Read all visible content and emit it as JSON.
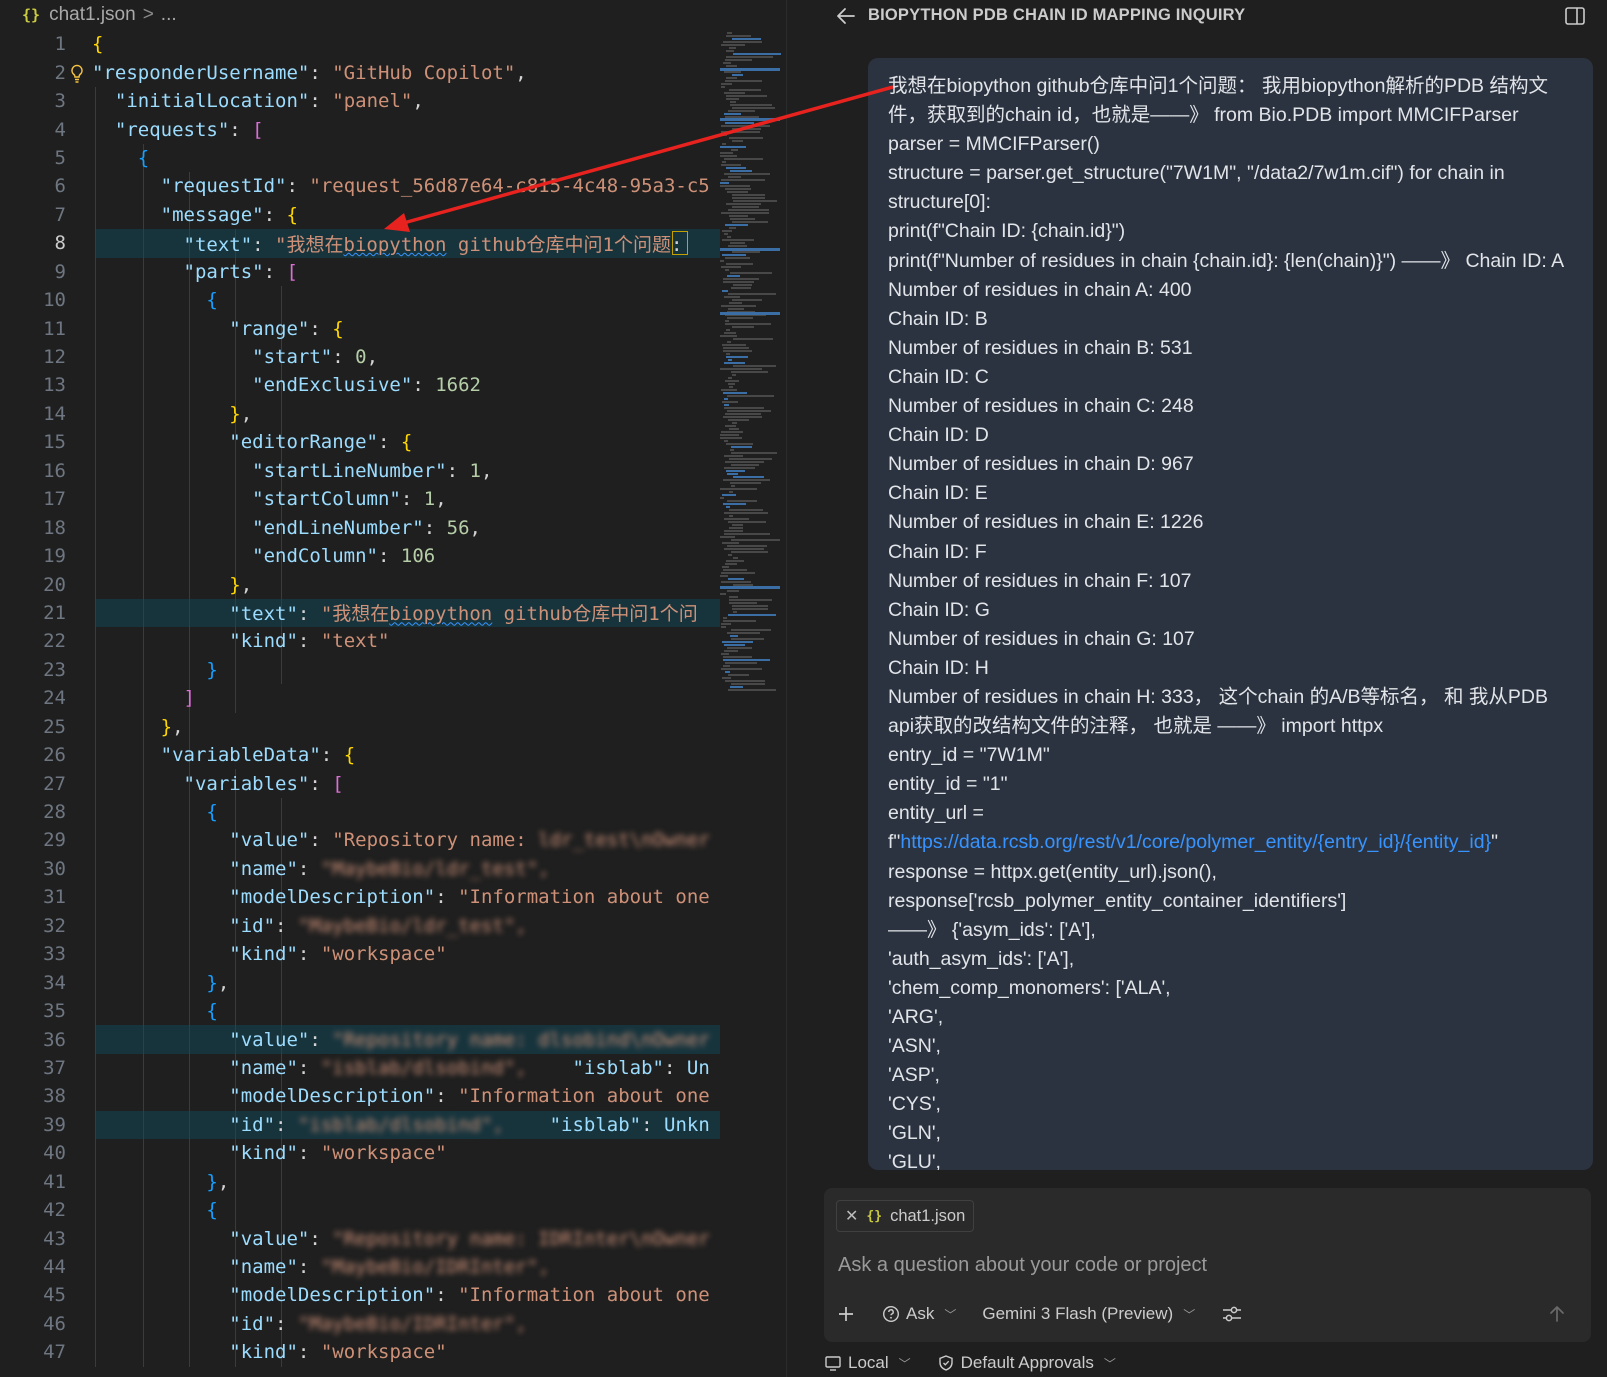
{
  "editor": {
    "breadcrumb": {
      "file_icon": "{}",
      "file": "chat1.json",
      "separator": ">",
      "more": "..."
    },
    "lines": [
      {
        "n": "1",
        "tokens": [
          [
            "b1",
            "{"
          ]
        ]
      },
      {
        "n": "2",
        "bulb": true,
        "tokens": [
          [
            "k",
            "\"responderUsername\""
          ],
          [
            "p",
            ": "
          ],
          [
            "s",
            "\"GitHub Copilot\""
          ],
          [
            "p",
            ","
          ]
        ]
      },
      {
        "n": "3",
        "tokens": [
          [
            "p",
            "  "
          ],
          [
            "k",
            "\"initialLocation\""
          ],
          [
            "p",
            ": "
          ],
          [
            "s",
            "\"panel\""
          ],
          [
            "p",
            ","
          ]
        ]
      },
      {
        "n": "4",
        "tokens": [
          [
            "p",
            "  "
          ],
          [
            "k",
            "\"requests\""
          ],
          [
            "p",
            ": "
          ],
          [
            "b2",
            "["
          ]
        ]
      },
      {
        "n": "5",
        "tokens": [
          [
            "p",
            "    "
          ],
          [
            "b3",
            "{"
          ]
        ]
      },
      {
        "n": "6",
        "tokens": [
          [
            "p",
            "      "
          ],
          [
            "k",
            "\"requestId\""
          ],
          [
            "p",
            ": "
          ],
          [
            "s",
            "\"request_56d87e64-c815-4c48-95a3-c5"
          ]
        ]
      },
      {
        "n": "7",
        "tokens": [
          [
            "p",
            "      "
          ],
          [
            "k",
            "\"message\""
          ],
          [
            "p",
            ": "
          ],
          [
            "b1",
            "{"
          ]
        ]
      },
      {
        "n": "8",
        "hl": true,
        "cur": true,
        "tokens": [
          [
            "p",
            "        "
          ],
          [
            "k",
            "\"text\""
          ],
          [
            "p",
            ": "
          ],
          [
            "s",
            "\"我想在"
          ],
          [
            "sq",
            "biopython"
          ],
          [
            "s",
            " github仓库中问1个问题"
          ],
          [
            "p",
            ":"
          ]
        ]
      },
      {
        "n": "9",
        "tokens": [
          [
            "p",
            "        "
          ],
          [
            "k",
            "\"parts\""
          ],
          [
            "p",
            ": "
          ],
          [
            "b2",
            "["
          ]
        ]
      },
      {
        "n": "10",
        "tokens": [
          [
            "p",
            "          "
          ],
          [
            "b3",
            "{"
          ]
        ]
      },
      {
        "n": "11",
        "tokens": [
          [
            "p",
            "            "
          ],
          [
            "k",
            "\"range\""
          ],
          [
            "p",
            ": "
          ],
          [
            "b1",
            "{"
          ]
        ]
      },
      {
        "n": "12",
        "tokens": [
          [
            "p",
            "              "
          ],
          [
            "k",
            "\"start\""
          ],
          [
            "p",
            ": "
          ],
          [
            "n",
            "0"
          ],
          [
            "p",
            ","
          ]
        ]
      },
      {
        "n": "13",
        "tokens": [
          [
            "p",
            "              "
          ],
          [
            "k",
            "\"endExclusive\""
          ],
          [
            "p",
            ": "
          ],
          [
            "n",
            "1662"
          ]
        ]
      },
      {
        "n": "14",
        "tokens": [
          [
            "p",
            "            "
          ],
          [
            "b1",
            "}"
          ],
          [
            "p",
            ","
          ]
        ]
      },
      {
        "n": "15",
        "tokens": [
          [
            "p",
            "            "
          ],
          [
            "k",
            "\"editorRange\""
          ],
          [
            "p",
            ": "
          ],
          [
            "b1",
            "{"
          ]
        ]
      },
      {
        "n": "16",
        "tokens": [
          [
            "p",
            "              "
          ],
          [
            "k",
            "\"startLineNumber\""
          ],
          [
            "p",
            ": "
          ],
          [
            "n",
            "1"
          ],
          [
            "p",
            ","
          ]
        ]
      },
      {
        "n": "17",
        "tokens": [
          [
            "p",
            "              "
          ],
          [
            "k",
            "\"startColumn\""
          ],
          [
            "p",
            ": "
          ],
          [
            "n",
            "1"
          ],
          [
            "p",
            ","
          ]
        ]
      },
      {
        "n": "18",
        "tokens": [
          [
            "p",
            "              "
          ],
          [
            "k",
            "\"endLineNumber\""
          ],
          [
            "p",
            ": "
          ],
          [
            "n",
            "56"
          ],
          [
            "p",
            ","
          ]
        ]
      },
      {
        "n": "19",
        "tokens": [
          [
            "p",
            "              "
          ],
          [
            "k",
            "\"endColumn\""
          ],
          [
            "p",
            ": "
          ],
          [
            "n",
            "106"
          ]
        ]
      },
      {
        "n": "20",
        "tokens": [
          [
            "p",
            "            "
          ],
          [
            "b1",
            "}"
          ],
          [
            "p",
            ","
          ]
        ]
      },
      {
        "n": "21",
        "hl": true,
        "tokens": [
          [
            "p",
            "            "
          ],
          [
            "k",
            "\"text\""
          ],
          [
            "p",
            ": "
          ],
          [
            "s",
            "\"我想在"
          ],
          [
            "sq",
            "biopython"
          ],
          [
            "s",
            " github仓库中问1个问"
          ]
        ]
      },
      {
        "n": "22",
        "tokens": [
          [
            "p",
            "            "
          ],
          [
            "k",
            "\"kind\""
          ],
          [
            "p",
            ": "
          ],
          [
            "s",
            "\"text\""
          ]
        ]
      },
      {
        "n": "23",
        "tokens": [
          [
            "p",
            "          "
          ],
          [
            "b3",
            "}"
          ]
        ]
      },
      {
        "n": "24",
        "tokens": [
          [
            "p",
            "        "
          ],
          [
            "b2",
            "]"
          ]
        ]
      },
      {
        "n": "25",
        "tokens": [
          [
            "p",
            "      "
          ],
          [
            "b1",
            "}"
          ],
          [
            "p",
            ","
          ]
        ]
      },
      {
        "n": "26",
        "tokens": [
          [
            "p",
            "      "
          ],
          [
            "k",
            "\"variableData\""
          ],
          [
            "p",
            ": "
          ],
          [
            "b1",
            "{"
          ]
        ]
      },
      {
        "n": "27",
        "tokens": [
          [
            "p",
            "        "
          ],
          [
            "k",
            "\"variables\""
          ],
          [
            "p",
            ": "
          ],
          [
            "b2",
            "["
          ]
        ]
      },
      {
        "n": "28",
        "tokens": [
          [
            "p",
            "          "
          ],
          [
            "b3",
            "{"
          ]
        ]
      },
      {
        "n": "29",
        "tokens": [
          [
            "p",
            "            "
          ],
          [
            "k",
            "\"value\""
          ],
          [
            "p",
            ": "
          ],
          [
            "s",
            "\"Repository name: "
          ],
          [
            "blur",
            "ldr_test\\nOwner"
          ]
        ]
      },
      {
        "n": "30",
        "tokens": [
          [
            "p",
            "            "
          ],
          [
            "k",
            "\"name\""
          ],
          [
            "p",
            ": "
          ],
          [
            "blur",
            "\"MaybeBio/ldr_test\","
          ]
        ]
      },
      {
        "n": "31",
        "tokens": [
          [
            "p",
            "            "
          ],
          [
            "k",
            "\"modelDescription\""
          ],
          [
            "p",
            ": "
          ],
          [
            "s",
            "\"Information about one"
          ]
        ]
      },
      {
        "n": "32",
        "tokens": [
          [
            "p",
            "            "
          ],
          [
            "k",
            "\"id\""
          ],
          [
            "p",
            ": "
          ],
          [
            "blur",
            "\"MaybeBio/ldr_test\","
          ]
        ]
      },
      {
        "n": "33",
        "tokens": [
          [
            "p",
            "            "
          ],
          [
            "k",
            "\"kind\""
          ],
          [
            "p",
            ": "
          ],
          [
            "s",
            "\"workspace\""
          ]
        ]
      },
      {
        "n": "34",
        "tokens": [
          [
            "p",
            "          "
          ],
          [
            "b3",
            "}"
          ],
          [
            "p",
            ","
          ]
        ]
      },
      {
        "n": "35",
        "tokens": [
          [
            "p",
            "          "
          ],
          [
            "b3",
            "{"
          ]
        ]
      },
      {
        "n": "36",
        "hl": true,
        "tokens": [
          [
            "p",
            "            "
          ],
          [
            "k",
            "\"value\""
          ],
          [
            "p",
            ": "
          ],
          [
            "blur",
            "\"Repository name: dlsobind\\nOwner"
          ]
        ]
      },
      {
        "n": "37",
        "tokens": [
          [
            "p",
            "            "
          ],
          [
            "k",
            "\"name\""
          ],
          [
            "p",
            ": "
          ],
          [
            "blur",
            "\"isblab/dlsobind\","
          ],
          [
            "p",
            "    "
          ],
          [
            "k",
            "\"isblab\""
          ],
          [
            "p",
            ": "
          ],
          [
            "k",
            "Un"
          ]
        ]
      },
      {
        "n": "38",
        "tokens": [
          [
            "p",
            "            "
          ],
          [
            "k",
            "\"modelDescription\""
          ],
          [
            "p",
            ": "
          ],
          [
            "s",
            "\"Information about one"
          ]
        ]
      },
      {
        "n": "39",
        "hl": true,
        "tokens": [
          [
            "p",
            "            "
          ],
          [
            "k",
            "\"id\""
          ],
          [
            "p",
            ": "
          ],
          [
            "blur",
            "\"isblab/dlsobind\","
          ],
          [
            "p",
            "    "
          ],
          [
            "k",
            "\"isblab\""
          ],
          [
            "p",
            ": "
          ],
          [
            "k",
            "Unkn"
          ]
        ]
      },
      {
        "n": "40",
        "tokens": [
          [
            "p",
            "            "
          ],
          [
            "k",
            "\"kind\""
          ],
          [
            "p",
            ": "
          ],
          [
            "s",
            "\"workspace\""
          ]
        ]
      },
      {
        "n": "41",
        "tokens": [
          [
            "p",
            "          "
          ],
          [
            "b3",
            "}"
          ],
          [
            "p",
            ","
          ]
        ]
      },
      {
        "n": "42",
        "tokens": [
          [
            "p",
            "          "
          ],
          [
            "b3",
            "{"
          ]
        ]
      },
      {
        "n": "43",
        "tokens": [
          [
            "p",
            "            "
          ],
          [
            "k",
            "\"value\""
          ],
          [
            "p",
            ": "
          ],
          [
            "blur",
            "\"Repository name: IDRInter\\nOwner"
          ]
        ]
      },
      {
        "n": "44",
        "tokens": [
          [
            "p",
            "            "
          ],
          [
            "k",
            "\"name\""
          ],
          [
            "p",
            ": "
          ],
          [
            "blur",
            "\"MaybeBio/IDRInter\","
          ]
        ]
      },
      {
        "n": "45",
        "tokens": [
          [
            "p",
            "            "
          ],
          [
            "k",
            "\"modelDescription\""
          ],
          [
            "p",
            ": "
          ],
          [
            "s",
            "\"Information about one"
          ]
        ]
      },
      {
        "n": "46",
        "tokens": [
          [
            "p",
            "            "
          ],
          [
            "k",
            "\"id\""
          ],
          [
            "p",
            ": "
          ],
          [
            "blur",
            "\"MaybeBio/IDRInter\","
          ]
        ]
      },
      {
        "n": "47",
        "tokens": [
          [
            "p",
            "            "
          ],
          [
            "k",
            "\"kind\""
          ],
          [
            "p",
            ": "
          ],
          [
            "s",
            "\"workspace\""
          ]
        ]
      }
    ]
  },
  "chat": {
    "title": "BIOPYTHON PDB CHAIN ID MAPPING INQUIRY",
    "message_lines": [
      "我想在biopython github仓库中问1个问题：  我用biopython解析的PDB 结构文件，获取到的chain id，也就是——》 from Bio.PDB import MMCIFParser",
      "parser = MMCIFParser()",
      "structure = parser.get_structure(\"7W1M\", \"/data2/7w1m.cif\") for chain in structure[0]:",
      "print(f\"Chain ID: {chain.id}\")",
      "print(f\"Number of residues in chain {chain.id}: {len(chain)}\") ——》  Chain ID: A",
      "Number of residues in chain A: 400",
      "Chain ID: B",
      "Number of residues in chain B: 531",
      "Chain ID: C",
      "Number of residues in chain C: 248",
      "Chain ID: D",
      "Number of residues in chain D: 967",
      "Chain ID: E",
      "Number of residues in chain E: 1226",
      "Chain ID: F",
      "Number of residues in chain F: 107",
      "Chain ID: G",
      "Number of residues in chain G: 107",
      "Chain ID: H",
      "Number of residues in chain H: 333，  这个chain 的A/B等标名，  和 我从PDB api获取的改结构文件的注释，  也就是 ——》  import httpx",
      "entry_id = \"7W1M\"",
      "entity_id = \"1\"",
      "entity_url =",
      "response = httpx.get(entity_url).json(),",
      "response['rcsb_polymer_entity_container_identifiers']",
      "——》  {'asym_ids': ['A'],",
      "'auth_asym_ids': ['A'],",
      "'chem_comp_monomers': ['ALA',",
      "'ARG',",
      "'ASN',",
      "'ASP',",
      "'CYS',",
      "'GLN',",
      "'GLU',"
    ],
    "url_prefix": "f\"",
    "url": "https://data.rcsb.org/rest/v1/core/polymer_entity/{entry_id}/{entity_id}",
    "url_suffix": "\"",
    "attachment": {
      "icon": "{}",
      "name": "chat1.json"
    },
    "input_placeholder": "Ask a question about your code or project",
    "mode_label": "Ask",
    "model_label": "Gemini 3 Flash (Preview)",
    "location_label": "Local",
    "approvals_label": "Default Approvals"
  },
  "colors": {
    "accent": "#3794ff",
    "annotation_arrow": "#e8231f",
    "bubble": "#2c3340"
  }
}
